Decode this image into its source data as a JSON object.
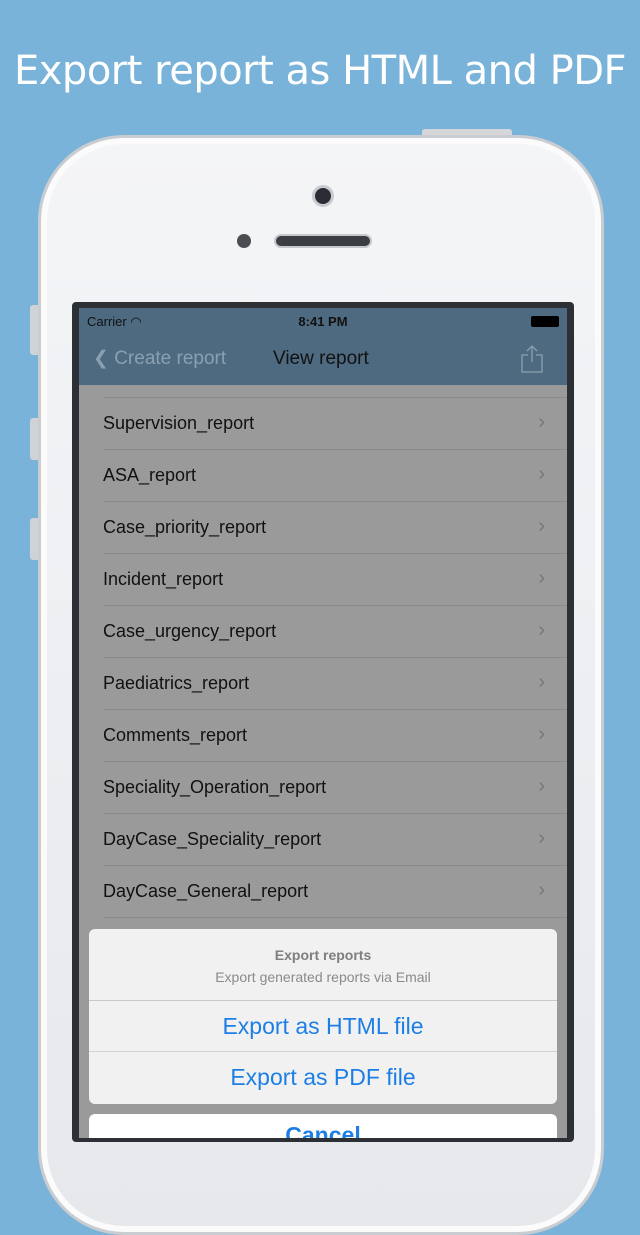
{
  "headline": "Export report as HTML and PDF",
  "status": {
    "carrier": "Carrier",
    "time": "8:41 PM"
  },
  "nav": {
    "back_label": "Create report",
    "title": "View report"
  },
  "reports": [
    "Supervision_report",
    "ASA_report",
    "Case_priority_report",
    "Incident_report",
    "Case_urgency_report",
    "Paediatrics_report",
    "Comments_report",
    "Speciality_Operation_report",
    "DayCase_Speciality_report",
    "DayCase_General_report"
  ],
  "action_sheet": {
    "title": "Export reports",
    "message": "Export generated reports via Email",
    "options": [
      "Export as HTML file",
      "Export as PDF file"
    ],
    "cancel": "Cancel"
  },
  "colors": {
    "background": "#79b3d9",
    "nav": "#4d6a80",
    "action": "#1d7fe5"
  }
}
